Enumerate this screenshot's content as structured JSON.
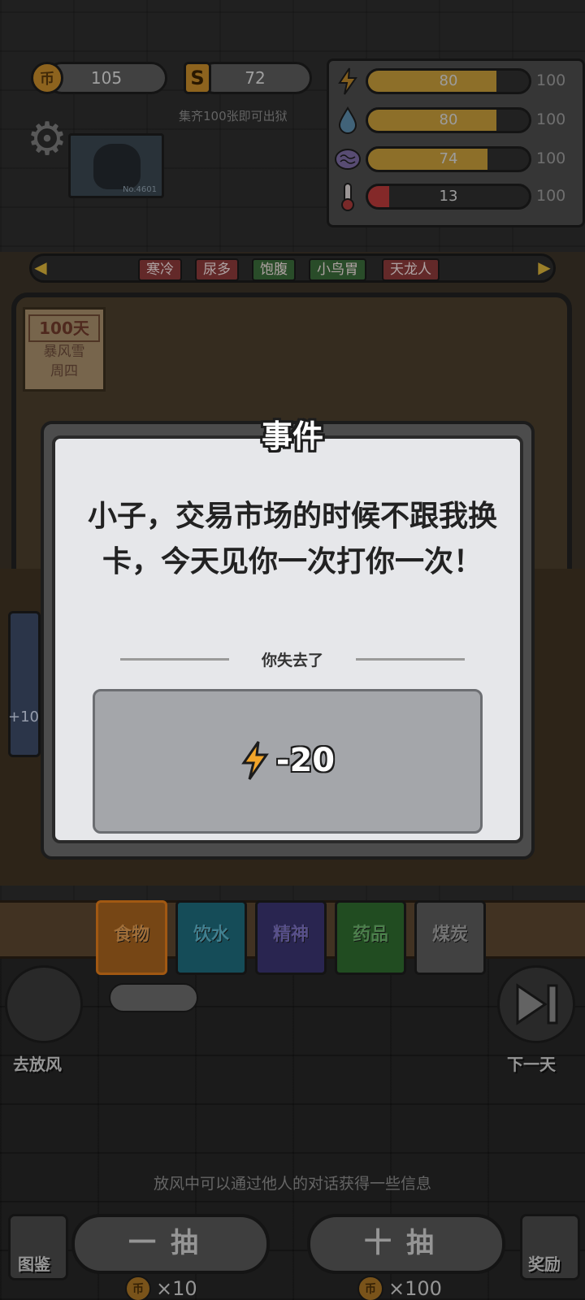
{
  "top": {
    "coins": "105",
    "cards": "72",
    "coin_icon": "币",
    "card_icon": "S",
    "hint": "集齐100张即可出狱"
  },
  "stats": [
    {
      "icon": "lightning-icon",
      "value": "80",
      "max": "100",
      "level": 0.8,
      "color": "#c49a3a"
    },
    {
      "icon": "water-drop-icon",
      "value": "80",
      "max": "100",
      "level": 0.8,
      "color": "#c49a3a"
    },
    {
      "icon": "brain-icon",
      "value": "74",
      "max": "100",
      "level": 0.74,
      "color": "#c49a3a"
    },
    {
      "icon": "thermometer-icon",
      "value": "13",
      "max": "100",
      "level": 0.13,
      "color": "#b83a3a"
    }
  ],
  "portrait": {
    "id": "No.4601"
  },
  "tags": [
    "寒冷",
    "尿多",
    "饱腹",
    "小鸟胃",
    "天龙人"
  ],
  "calendar": {
    "day": "100天",
    "weather": "暴风雪",
    "weekday": "周四"
  },
  "side_card": {
    "label": "+10"
  },
  "event": {
    "title": "事件",
    "message": "小子，交易市场的时候不跟我换卡，今天见你一次打你一次！",
    "lost_label": "你失去了",
    "lost_value": "-20",
    "lost_icon": "lightning-icon"
  },
  "categories": [
    "食物",
    "饮水",
    "精神",
    "药品",
    "煤炭"
  ],
  "buttons": {
    "go_out": "去放风",
    "next_day": "下一天",
    "handbook": "图鉴",
    "reward": "奖励",
    "draw_one": "一抽",
    "draw_ten": "十抽",
    "draw_one_cost": "×10",
    "draw_ten_cost": "×100"
  },
  "info": "放风中可以通过他人的对话获得一些信息",
  "colors": {
    "accent_gold": "#c49a3a",
    "danger_red": "#b83a3a",
    "modal_bg": "#e6e7ea"
  }
}
